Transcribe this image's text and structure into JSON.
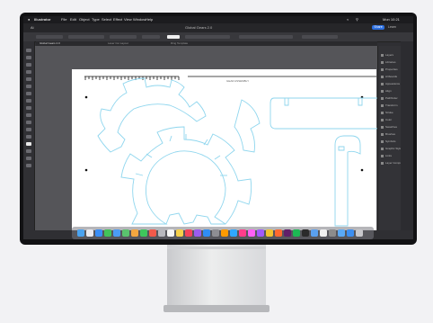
{
  "menubar": {
    "apple": "",
    "app_name": "Illustrator",
    "items": [
      "File",
      "Edit",
      "Object",
      "Type",
      "Select",
      "Effect",
      "View",
      "Window",
      "Help"
    ],
    "status_time": "Mon 10:21"
  },
  "app": {
    "home_label": "Ai",
    "doc_title": "Global Gears 2.0",
    "share_label": "Share",
    "learn_label": "Learn"
  },
  "tabs": [
    "Global Gears 2.0",
    "Laser Cut Layout",
    "Ring Template"
  ],
  "canvas_label": "GEAR ASSEMBLY",
  "properties": [
    "Layers",
    "Libraries",
    "Properties",
    "Artboards",
    "Appearance",
    "Align",
    "Pathfinder",
    "Transform",
    "Stroke",
    "Color",
    "Swatches",
    "Brushes",
    "Symbols",
    "Graphic Styles",
    "Links",
    "Layer Comps"
  ],
  "colors": {
    "cut_line": "#8fd6ee",
    "accent": "#2c6fe0",
    "bezel": "#121214"
  },
  "dock_icons": [
    "finder-icon",
    "launchpad-icon",
    "safari-icon",
    "messages-icon",
    "mail-icon",
    "maps-icon",
    "photos-icon",
    "facetime-icon",
    "calendar-icon",
    "contacts-icon",
    "reminders-icon",
    "notes-icon",
    "music-icon",
    "podcasts-icon",
    "appstore-icon",
    "settings-icon",
    "illustrator-icon",
    "photoshop-icon",
    "indesign-icon",
    "xd-icon",
    "figma-icon",
    "chrome-icon",
    "firefox-icon",
    "slack-icon",
    "spotify-icon",
    "terminal-icon",
    "preview-icon",
    "textedit-icon",
    "calculator-icon",
    "folder-icon",
    "downloads-icon",
    "trash-icon"
  ]
}
